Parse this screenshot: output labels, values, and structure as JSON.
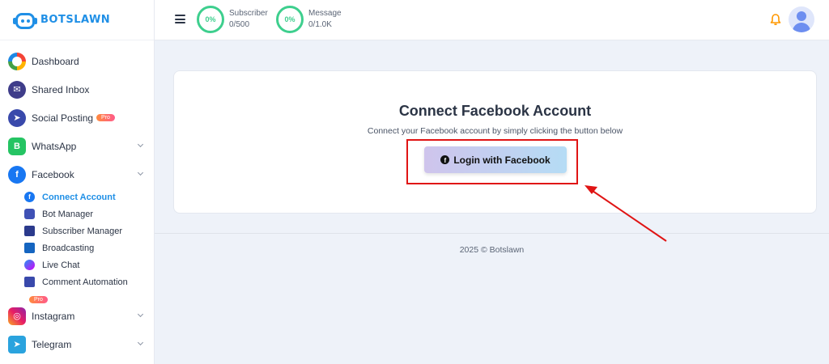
{
  "brand": {
    "name": "BOTSLAWN"
  },
  "sidebar": {
    "items": [
      {
        "label": "Dashboard"
      },
      {
        "label": "Shared Inbox"
      },
      {
        "label": "Social Posting",
        "badge": "Pro"
      },
      {
        "label": "WhatsApp"
      },
      {
        "label": "Facebook"
      },
      {
        "label": "Instagram"
      },
      {
        "label": "Telegram"
      }
    ],
    "facebook_sub": [
      {
        "label": "Connect Account",
        "active": true
      },
      {
        "label": "Bot Manager"
      },
      {
        "label": "Subscriber Manager"
      },
      {
        "label": "Broadcasting"
      },
      {
        "label": "Live Chat"
      },
      {
        "label": "Comment Automation",
        "badge": "Pro"
      }
    ]
  },
  "header": {
    "subscriber": {
      "percent": "0%",
      "label": "Subscriber",
      "value": "0/500"
    },
    "message": {
      "percent": "0%",
      "label": "Message",
      "value": "0/1.0K"
    }
  },
  "main": {
    "title": "Connect Facebook Account",
    "description": "Connect your Facebook account by simply clicking the button below",
    "button_label": "Login with Facebook"
  },
  "footer": {
    "text": "2025 © Botslawn"
  },
  "colors": {
    "accent": "#1f8fe6",
    "ring": "#3ecf8e",
    "annotation": "#e01414"
  }
}
